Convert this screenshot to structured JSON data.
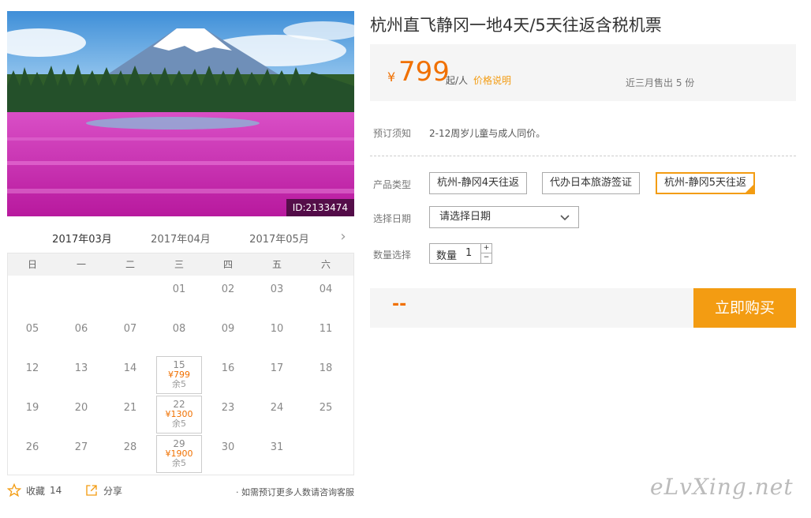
{
  "hero": {
    "id_label": "ID:2133474"
  },
  "months": {
    "tabs": [
      "2017年03月",
      "2017年04月",
      "2017年05月"
    ],
    "next_icon": "›"
  },
  "calendar": {
    "weekdays": [
      "日",
      "一",
      "二",
      "三",
      "四",
      "五",
      "六"
    ],
    "rows": [
      [
        {
          "d": ""
        },
        {
          "d": ""
        },
        {
          "d": ""
        },
        {
          "d": "01"
        },
        {
          "d": "02"
        },
        {
          "d": "03"
        },
        {
          "d": "04"
        }
      ],
      [
        {
          "d": "05"
        },
        {
          "d": "06"
        },
        {
          "d": "07"
        },
        {
          "d": "08"
        },
        {
          "d": "09"
        },
        {
          "d": "10"
        },
        {
          "d": "11"
        }
      ],
      [
        {
          "d": "12"
        },
        {
          "d": "13"
        },
        {
          "d": "14"
        },
        {
          "d": "15",
          "p": "¥799",
          "s": "余5"
        },
        {
          "d": "16"
        },
        {
          "d": "17"
        },
        {
          "d": "18"
        }
      ],
      [
        {
          "d": "19"
        },
        {
          "d": "20"
        },
        {
          "d": "21"
        },
        {
          "d": "22",
          "p": "¥1300",
          "s": "余5"
        },
        {
          "d": "23"
        },
        {
          "d": "24"
        },
        {
          "d": "25"
        }
      ],
      [
        {
          "d": "26"
        },
        {
          "d": "27"
        },
        {
          "d": "28"
        },
        {
          "d": "29",
          "p": "¥1900",
          "s": "余5"
        },
        {
          "d": "30"
        },
        {
          "d": "31"
        },
        {
          "d": ""
        }
      ]
    ]
  },
  "footer": {
    "fav_label": "收藏",
    "fav_count": "14",
    "share_label": "分享",
    "consult": "· 如需预订更多人数请咨询客服"
  },
  "product": {
    "title": "杭州直飞静冈一地4天/5天往返含税机票",
    "currency": "¥",
    "price": "799",
    "per": "起/人",
    "price_note": "价格说明",
    "sold": "近三月售出 5 份",
    "notice_label": "预订须知",
    "notice": "2-12周岁儿童与成人同价。",
    "type_label": "产品类型",
    "types": [
      "杭州-静冈4天往返",
      "代办日本旅游签证",
      "杭州-静冈5天往返"
    ],
    "selected_type": 2,
    "date_label": "选择日期",
    "date_placeholder": "请选择日期",
    "qty_label": "数量选择",
    "qty_inner_label": "数量",
    "qty_value": "1",
    "total": "--",
    "buy": "立即购买"
  },
  "watermark": "eLvXing.net",
  "colors": {
    "accent": "#f39c12",
    "price": "#f07000"
  }
}
